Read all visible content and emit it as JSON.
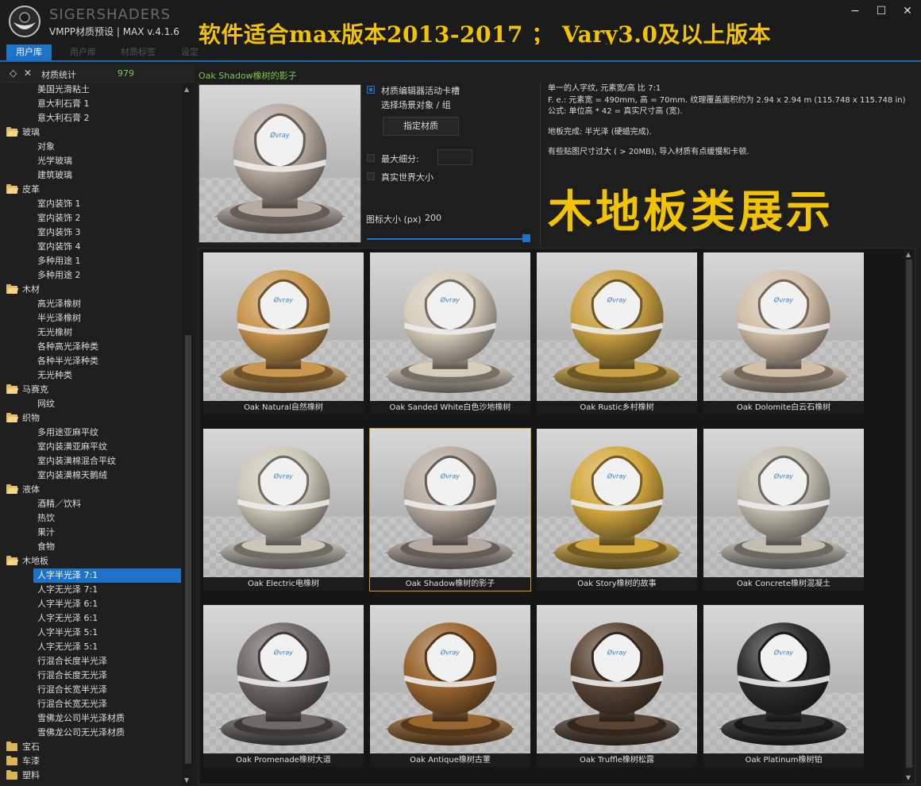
{
  "app": {
    "brand": "SIGERSHADERS",
    "subtitle": "VMPP材质预设 | MAX v.4.1.6",
    "banner": "软件适合max版本2013-2017 ； Vary3.0及以上版本",
    "window_controls": {
      "minimize": "−",
      "maximize": "☐",
      "close": "✕"
    }
  },
  "tabs": [
    {
      "label": "用户库",
      "active": true
    },
    {
      "label": "用户库",
      "active": false
    },
    {
      "label": "材质标签",
      "active": false
    },
    {
      "label": "设定",
      "active": false
    }
  ],
  "tree_header": {
    "expand_icon": "◇",
    "close_icon": "✕",
    "label": "材质统计",
    "count": "979"
  },
  "tree": [
    {
      "label": "美国光滑粘土",
      "type": "child"
    },
    {
      "label": "意大利石膏 1",
      "type": "child"
    },
    {
      "label": "意大利石膏 2",
      "type": "child"
    },
    {
      "label": "玻璃",
      "type": "cat",
      "open": true
    },
    {
      "label": "对象",
      "type": "child"
    },
    {
      "label": "光学玻璃",
      "type": "child"
    },
    {
      "label": "建筑玻璃",
      "type": "child"
    },
    {
      "label": "皮革",
      "type": "cat",
      "open": true
    },
    {
      "label": "室内装饰 1",
      "type": "child"
    },
    {
      "label": "室内装饰 2",
      "type": "child"
    },
    {
      "label": "室内装饰 3",
      "type": "child"
    },
    {
      "label": "室内装饰 4",
      "type": "child"
    },
    {
      "label": "多种用途 1",
      "type": "child"
    },
    {
      "label": "多种用途 2",
      "type": "child"
    },
    {
      "label": "木材",
      "type": "cat",
      "open": true
    },
    {
      "label": "高光泽橡树",
      "type": "child"
    },
    {
      "label": "半光泽橡树",
      "type": "child"
    },
    {
      "label": "无光橡树",
      "type": "child"
    },
    {
      "label": "各种高光泽种类",
      "type": "child"
    },
    {
      "label": "各种半光泽种类",
      "type": "child"
    },
    {
      "label": "无光种类",
      "type": "child"
    },
    {
      "label": "马赛克",
      "type": "cat",
      "open": true
    },
    {
      "label": "网纹",
      "type": "child"
    },
    {
      "label": "织物",
      "type": "cat",
      "open": true
    },
    {
      "label": "多用途亚麻平纹",
      "type": "child"
    },
    {
      "label": "室内装潢亚麻平纹",
      "type": "child"
    },
    {
      "label": "室内装潢棉混合平纹",
      "type": "child"
    },
    {
      "label": "室内装潢棉天鹅绒",
      "type": "child"
    },
    {
      "label": "液体",
      "type": "cat",
      "open": true
    },
    {
      "label": "酒精／饮料",
      "type": "child"
    },
    {
      "label": "热饮",
      "type": "child"
    },
    {
      "label": "果汁",
      "type": "child"
    },
    {
      "label": "食物",
      "type": "child"
    },
    {
      "label": "木地板",
      "type": "cat",
      "open": true
    },
    {
      "label": "人字半光泽 7:1",
      "type": "child",
      "selected": true
    },
    {
      "label": "人字无光泽 7:1",
      "type": "child"
    },
    {
      "label": "人字半光泽 6:1",
      "type": "child"
    },
    {
      "label": "人字无光泽 6:1",
      "type": "child"
    },
    {
      "label": "人字半光泽 5:1",
      "type": "child"
    },
    {
      "label": "人字无光泽 5:1",
      "type": "child"
    },
    {
      "label": "行混合长度半光泽",
      "type": "child"
    },
    {
      "label": "行混合长度无光泽",
      "type": "child"
    },
    {
      "label": "行混合长宽半光泽",
      "type": "child"
    },
    {
      "label": "行混合长宽无光泽",
      "type": "child"
    },
    {
      "label": "雪佛龙公司半光泽材质",
      "type": "child"
    },
    {
      "label": "雪佛龙公司无光泽材质",
      "type": "child"
    },
    {
      "label": "宝石",
      "type": "cat",
      "open": false
    },
    {
      "label": "车漆",
      "type": "cat",
      "open": false
    },
    {
      "label": "塑料",
      "type": "cat",
      "open": false
    }
  ],
  "preview": {
    "title": "Oak Shadow橡树的影子",
    "sphere_color": "#b7aaa0"
  },
  "options": {
    "active_slot_label": "材质编辑器活动卡槽",
    "active_slot_checked": true,
    "selection_label": "选择场景对象 / 组",
    "assign_button": "指定材质",
    "max_subdiv_label": "最大细分:",
    "max_subdiv_checked": false,
    "real_world_label": "真实世界大小",
    "real_world_checked": false,
    "icon_size_label": "图标大小 (px)",
    "icon_size_value": "200",
    "icon_size_fraction": 1.0
  },
  "info": {
    "lines": [
      "单一的人字纹, 元素宽/高 比 7:1",
      "F. e.: 元素宽 = 490mm, 高 = 70mm. 纹理覆盖面积约为 2.94 x 2.94 m (115.748 x 115.748 in)",
      "公式: 单位高 * 42 = 真实尺寸高 (宽).",
      "地板完成: 半光泽 (硬蜡完成).",
      "有些贴图尺寸过大 ( > 20MB), 导入材质有点缓慢和卡顿."
    ]
  },
  "overlay_title": "木地板类展示",
  "materials": [
    {
      "name": "Oak Natural自然橡树",
      "color": "#c9974e",
      "selected": false
    },
    {
      "name": "Oak Sanded White白色沙地橡树",
      "color": "#d6cdbb",
      "selected": false
    },
    {
      "name": "Oak Rustic乡村橡树",
      "color": "#c9a043",
      "selected": false
    },
    {
      "name": "Oak Dolomite白云石橡树",
      "color": "#d2bfa8",
      "selected": false
    },
    {
      "name": "Oak Electric电橡树",
      "color": "#cbc7b8",
      "selected": false
    },
    {
      "name": "Oak Shadow橡树的影子",
      "color": "#b7aaa0",
      "selected": true
    },
    {
      "name": "Oak Story橡树的故事",
      "color": "#d3a83f",
      "selected": false
    },
    {
      "name": "Oak Concrete橡树混凝土",
      "color": "#c2bfb1",
      "selected": false
    },
    {
      "name": "Oak Promenade橡树大道",
      "color": "#6f6a68",
      "selected": false
    },
    {
      "name": "Oak Antique橡树古董",
      "color": "#9a6630",
      "selected": false
    },
    {
      "name": "Oak Truffle橡树松露",
      "color": "#5a4534",
      "selected": false
    },
    {
      "name": "Oak Platinum橡树铂",
      "color": "#2e2e2e",
      "selected": false
    }
  ],
  "colors": {
    "accent": "#1e73c9",
    "banner": "#f2c300",
    "label_green": "#7ec84a",
    "selection_outline": "#d69a2a"
  }
}
